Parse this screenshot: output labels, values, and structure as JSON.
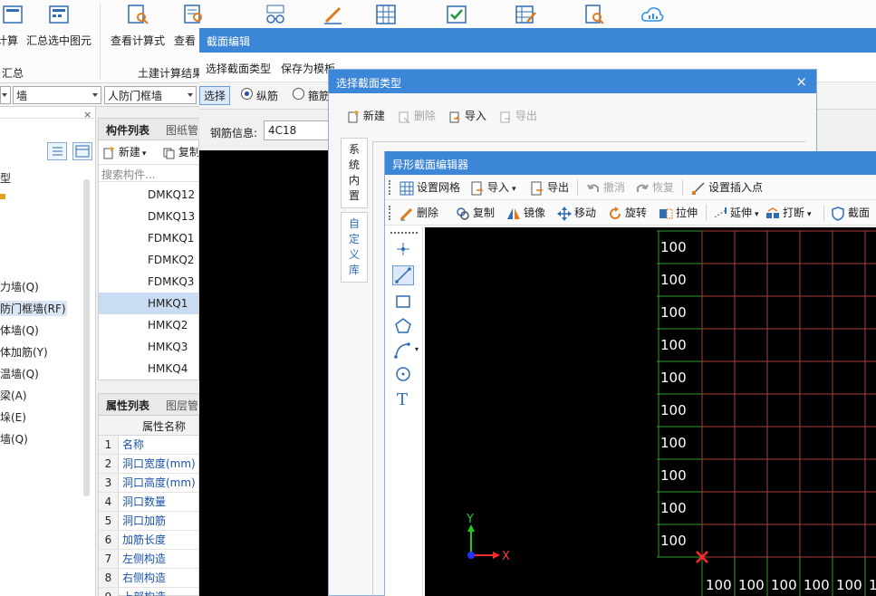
{
  "ribbon": {
    "buttons": [
      {
        "label": "计算",
        "icon": "calc-icon"
      },
      {
        "label": "汇总选中图元",
        "icon": "summary-selected-icon"
      },
      {
        "label": "查看计算式",
        "icon": "view-formula-icon"
      },
      {
        "label": "查看",
        "icon": "view-report-icon"
      },
      {
        "label": "",
        "icon": "compare-glasses-icon"
      },
      {
        "label": "",
        "icon": "edit-pencil-icon"
      },
      {
        "label": "",
        "icon": "scaffold-grid-icon"
      },
      {
        "label": "",
        "icon": "check-icon"
      },
      {
        "label": "",
        "icon": "table-edit-icon"
      },
      {
        "label": "",
        "icon": "report-search-icon"
      },
      {
        "label": "",
        "icon": "cloud-chart-icon"
      }
    ],
    "groups": {
      "summary": "汇总",
      "civil": "土建计算结果"
    }
  },
  "filter": {
    "combo1": "",
    "combo2": "墙",
    "combo3": "人防门框墙"
  },
  "tree": {
    "items": [
      "型",
      "",
      "",
      "力墙(Q)",
      "防门框墙(RF)",
      "体墙(Q)",
      "体加筋(Y)",
      "温墙(Q)",
      "梁(A)",
      "垛(E)",
      "墙(Q)"
    ],
    "selected_index": 4
  },
  "component_list": {
    "tabs": [
      "构件列表",
      "图纸管"
    ],
    "new_label": "新建",
    "copy_label": "复制",
    "search_placeholder": "搜索构件...",
    "items": [
      "DMKQ12",
      "DMKQ13",
      "FDMKQ1",
      "FDMKQ2",
      "FDMKQ3",
      "HMKQ1",
      "HMKQ2",
      "HMKQ3",
      "HMKQ4"
    ],
    "selected_index": 5
  },
  "property_list": {
    "tabs": [
      "属性列表",
      "图层管"
    ],
    "header": "属性名称",
    "rows": [
      {
        "no": "1",
        "name": "名称"
      },
      {
        "no": "2",
        "name": "洞口宽度(mm)"
      },
      {
        "no": "3",
        "name": "洞口高度(mm)"
      },
      {
        "no": "4",
        "name": "洞口数量"
      },
      {
        "no": "5",
        "name": "洞口加筋"
      },
      {
        "no": "6",
        "name": "加筋长度"
      },
      {
        "no": "7",
        "name": "左侧构造"
      },
      {
        "no": "8",
        "name": "右侧构造"
      },
      {
        "no": "9",
        "name": "上部构造"
      }
    ]
  },
  "section_edit": {
    "title": "截面编辑",
    "menu": [
      "选择截面类型",
      "保存为模板"
    ],
    "select_label": "选择",
    "radio_long": "纵筋",
    "radio_stirrup": "箍筋",
    "rebar_label": "钢筋信息:",
    "rebar_value": "4C18"
  },
  "select_type": {
    "title": "选择截面类型",
    "close": "×",
    "tool": {
      "new": "新建",
      "delete": "删除",
      "import": "导入",
      "export": "导出"
    },
    "tabs": [
      "系统内置",
      "自定义库"
    ]
  },
  "shape_editor": {
    "title": "异形截面编辑器",
    "toolbar1": {
      "grid": "设置网格",
      "import": "导入",
      "export": "导出",
      "undo": "撤消",
      "redo": "恢复",
      "insert_point": "设置插入点"
    },
    "toolbar2": {
      "delete": "删除",
      "copy": "复制",
      "mirror": "镜像",
      "move": "移动",
      "rotate": "旋转",
      "stretch": "拉伸",
      "extend": "延伸",
      "break": "打断",
      "section": "截面"
    },
    "grid": {
      "row_labels": [
        "100",
        "100",
        "100",
        "100",
        "100",
        "100",
        "100",
        "100",
        "100",
        "100"
      ],
      "col_labels": [
        "100",
        "100",
        "100",
        "100",
        "100",
        "1"
      ],
      "axis_x": "X",
      "axis_y": "Y"
    }
  },
  "colors": {
    "title_blue": "#3c86d8",
    "grid_red": "#b03a3a",
    "grid_green": "#2f9a2f",
    "link_blue": "#1a52a8"
  }
}
